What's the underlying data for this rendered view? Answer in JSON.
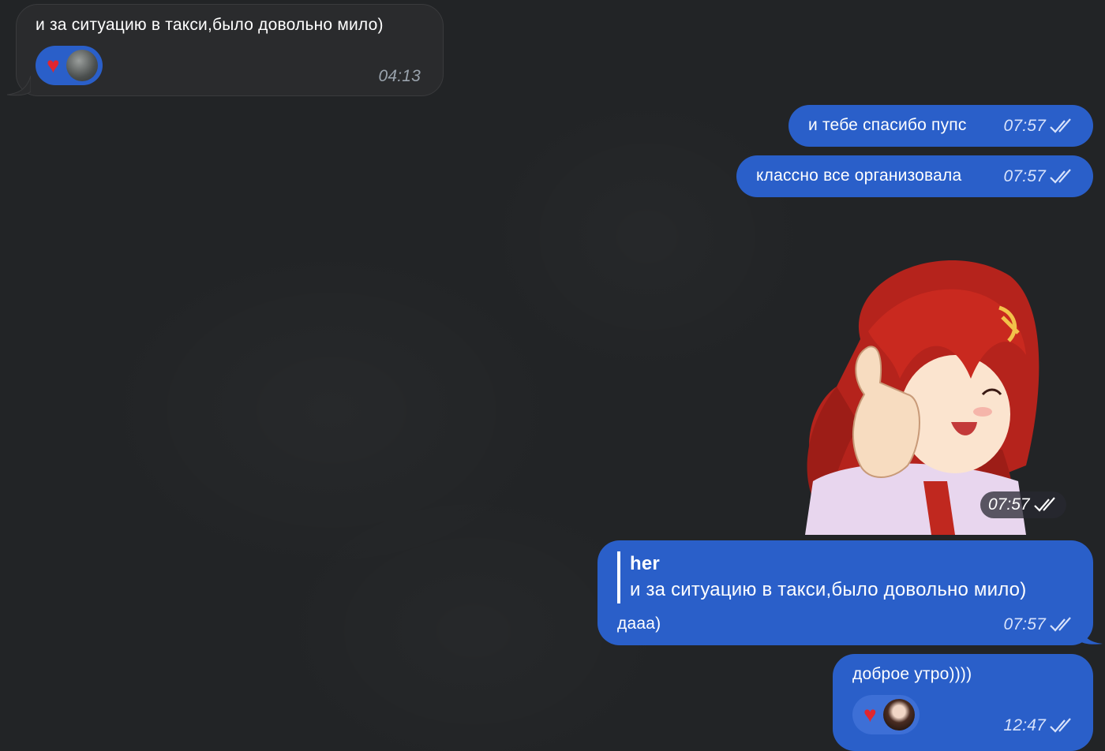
{
  "messages": {
    "m1": {
      "text": "и за ситуацию в такси,было довольно мило)",
      "time": "04:13"
    },
    "m2": {
      "text": "и тебе спасибо пупс",
      "time": "07:57"
    },
    "m3": {
      "text": "классно все организовала",
      "time": "07:57"
    },
    "sticker": {
      "time": "07:57"
    },
    "m4": {
      "quote_author": "her",
      "quote_text": "и за ситуацию в такси,было довольно мило)",
      "text": "дааа)",
      "time": "07:57"
    },
    "m5": {
      "text": "доброе утро))))",
      "time": "12:47"
    }
  },
  "reactions": {
    "r1": {
      "emoji": "♥"
    },
    "r2": {
      "emoji": "♥"
    }
  },
  "colors": {
    "background": "#222426",
    "incoming_bubble": "#2a2b2d",
    "outgoing_bubble": "#2a5fc9",
    "heart": "#e0262f"
  },
  "icons": {
    "read_status": "double-check-icon",
    "reaction": "heart-icon"
  }
}
